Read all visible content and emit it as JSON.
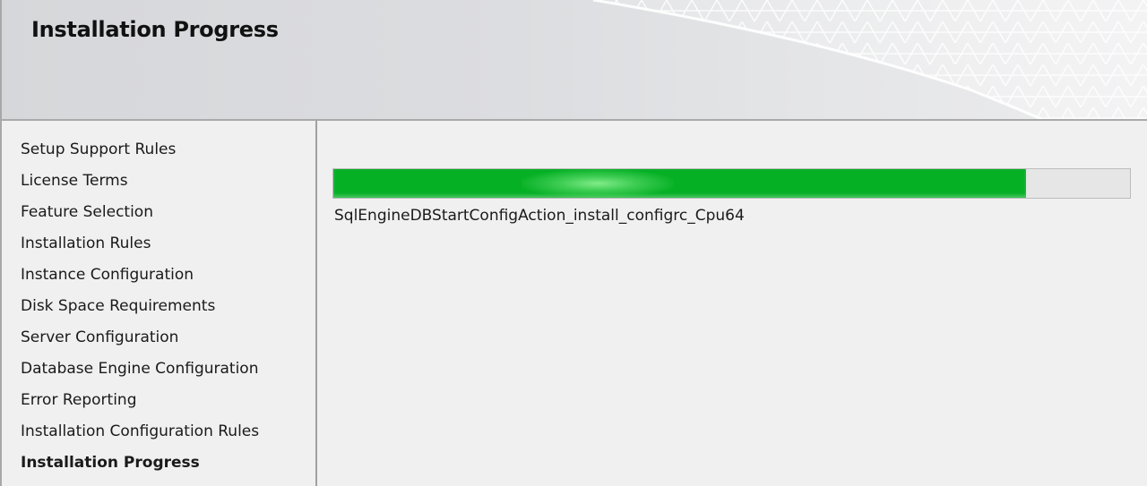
{
  "header": {
    "title": "Installation Progress"
  },
  "nav": {
    "items": [
      {
        "label": "Setup Support Rules",
        "active": false
      },
      {
        "label": "License Terms",
        "active": false
      },
      {
        "label": "Feature Selection",
        "active": false
      },
      {
        "label": "Installation Rules",
        "active": false
      },
      {
        "label": "Instance Configuration",
        "active": false
      },
      {
        "label": "Disk Space Requirements",
        "active": false
      },
      {
        "label": "Server Configuration",
        "active": false
      },
      {
        "label": "Database Engine Configuration",
        "active": false
      },
      {
        "label": "Error Reporting",
        "active": false
      },
      {
        "label": "Installation Configuration Rules",
        "active": false
      },
      {
        "label": "Installation Progress",
        "active": true
      }
    ]
  },
  "progress": {
    "percent": 87,
    "status_text": "SqlEngineDBStartConfigAction_install_configrc_Cpu64",
    "fill_color": "#06b025"
  }
}
